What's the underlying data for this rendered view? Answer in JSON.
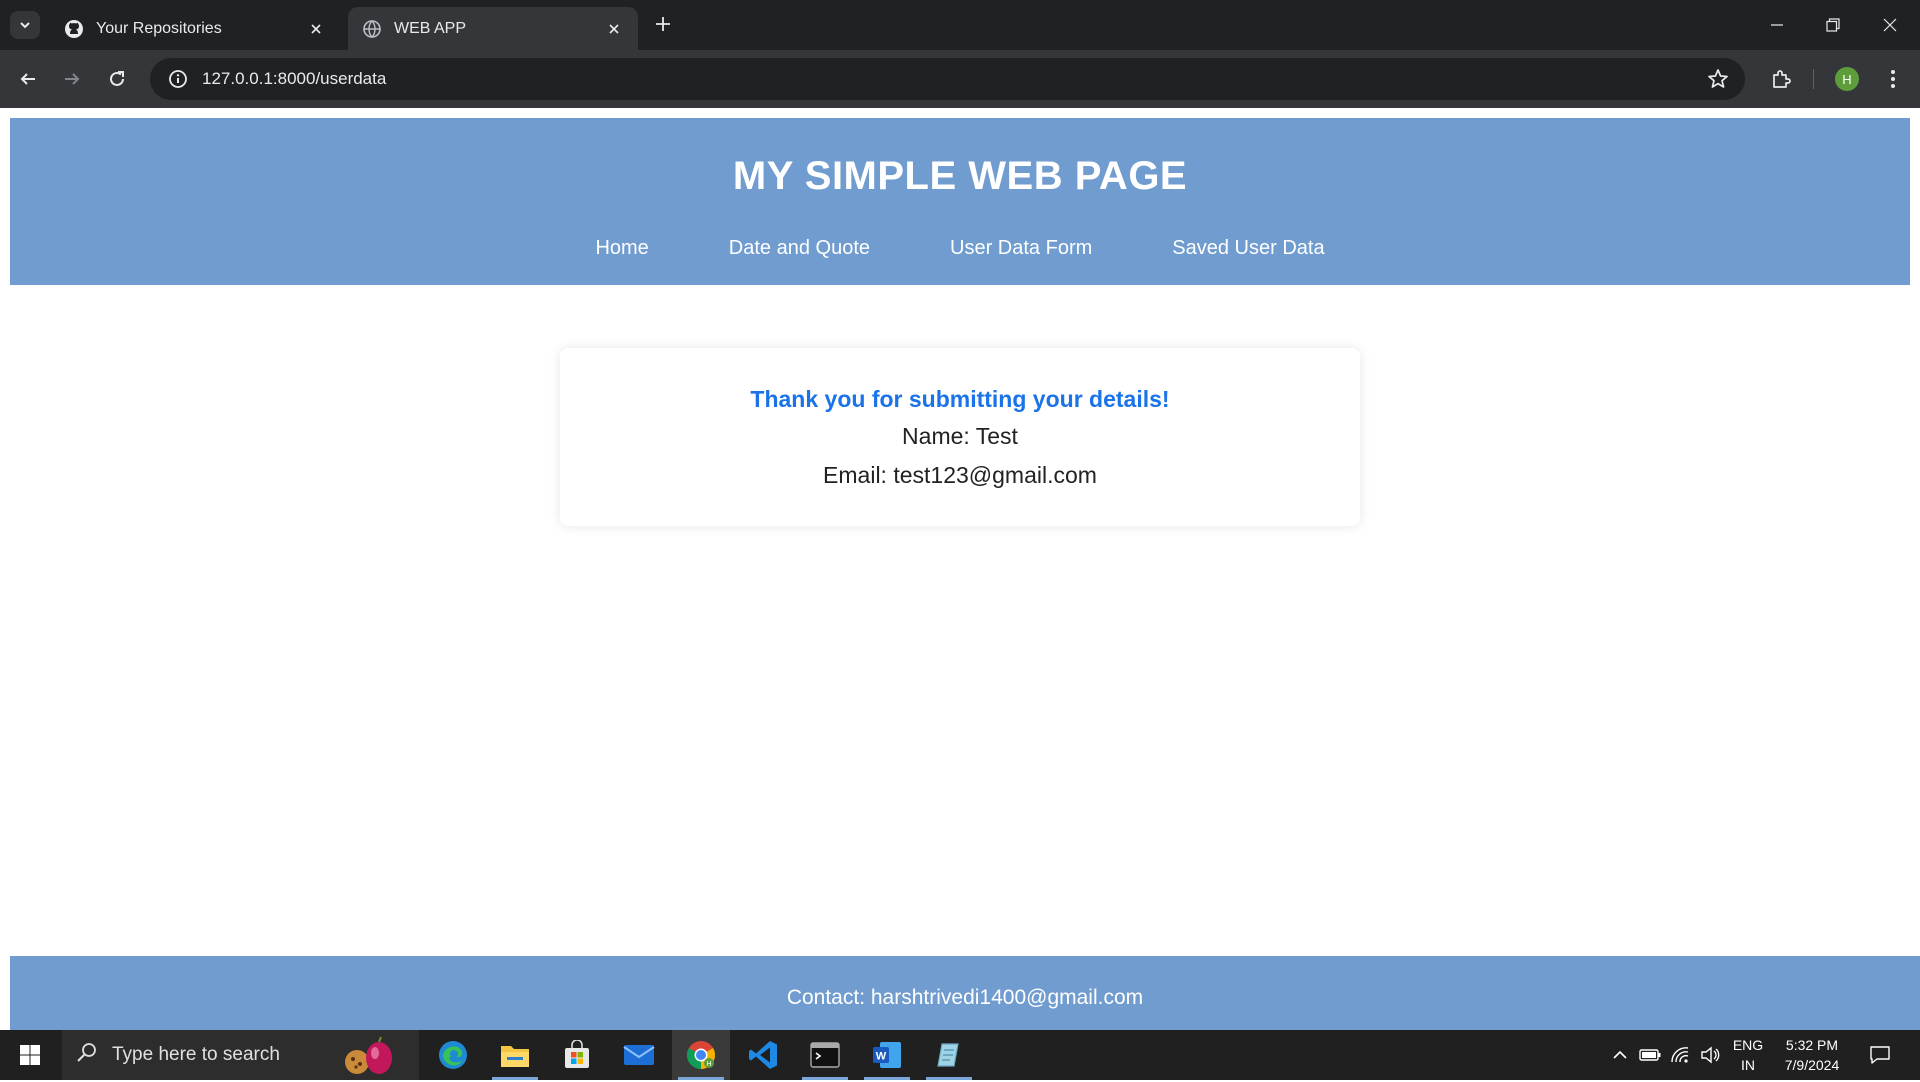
{
  "browser": {
    "tabs": [
      {
        "title": "Your Repositories",
        "icon": "github-icon",
        "active": false
      },
      {
        "title": "WEB APP",
        "icon": "globe-icon",
        "active": true
      }
    ],
    "url": "127.0.0.1:8000/userdata",
    "profile_initial": "H"
  },
  "site": {
    "title": "MY SIMPLE WEB PAGE",
    "nav": [
      "Home",
      "Date and Quote",
      "User Data Form",
      "Saved User Data"
    ],
    "confirmation": {
      "heading": "Thank you for submitting your details!",
      "name_line": "Name: Test",
      "email_line": "Email: test123@gmail.com"
    },
    "footer": {
      "contact": "Contact: harshtrivedi1400@gmail.com"
    },
    "colors": {
      "header_bg": "#709ccf",
      "heading_accent": "#1a73e8"
    }
  },
  "taskbar": {
    "search_placeholder": "Type here to search",
    "apps": [
      "edge-icon",
      "file-explorer-icon",
      "store-icon",
      "mail-icon",
      "chrome-icon",
      "vscode-icon",
      "terminal-icon",
      "word-icon",
      "notepad-icon"
    ],
    "language": {
      "line1": "ENG",
      "line2": "IN"
    },
    "time": "5:32 PM",
    "date": "7/9/2024"
  }
}
